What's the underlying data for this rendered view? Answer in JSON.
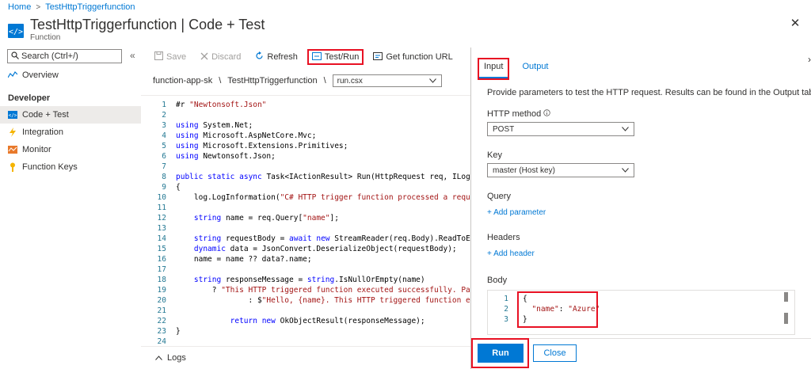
{
  "breadcrumb": {
    "home": "Home",
    "current": "TestHttpTriggerfunction"
  },
  "header": {
    "title": "TestHttpTriggerfunction | Code + Test",
    "subtitle": "Function",
    "close": "✕"
  },
  "sidebar": {
    "search_placeholder": "Search (Ctrl+/)",
    "collapse": "«",
    "overview": "Overview",
    "section_developer": "Developer",
    "items": [
      {
        "label": "Code + Test",
        "icon": "code-icon"
      },
      {
        "label": "Integration",
        "icon": "lightning-icon"
      },
      {
        "label": "Monitor",
        "icon": "monitor-icon"
      },
      {
        "label": "Function Keys",
        "icon": "key-icon"
      }
    ]
  },
  "toolbar": {
    "save": "Save",
    "discard": "Discard",
    "refresh": "Refresh",
    "test_run": "Test/Run",
    "get_url": "Get function URL"
  },
  "path": {
    "app": "function-app-sk",
    "sep1": "\\",
    "function": "TestHttpTriggerfunction",
    "sep2": "\\",
    "file": "run.csx"
  },
  "code_lines": [
    {
      "n": "1",
      "text": "#r \"Newtonsoft.Json\""
    },
    {
      "n": "2",
      "text": ""
    },
    {
      "n": "3",
      "text": "using System.Net;"
    },
    {
      "n": "4",
      "text": "using Microsoft.AspNetCore.Mvc;"
    },
    {
      "n": "5",
      "text": "using Microsoft.Extensions.Primitives;"
    },
    {
      "n": "6",
      "text": "using Newtonsoft.Json;"
    },
    {
      "n": "7",
      "text": ""
    },
    {
      "n": "8",
      "text": "public static async Task<IActionResult> Run(HttpRequest req, ILogger l"
    },
    {
      "n": "9",
      "text": "{"
    },
    {
      "n": "10",
      "text": "    log.LogInformation(\"C# HTTP trigger function processed a request.\""
    },
    {
      "n": "11",
      "text": ""
    },
    {
      "n": "12",
      "text": "    string name = req.Query[\"name\"];"
    },
    {
      "n": "13",
      "text": ""
    },
    {
      "n": "14",
      "text": "    string requestBody = await new StreamReader(req.Body).ReadToEndAsy"
    },
    {
      "n": "15",
      "text": "    dynamic data = JsonConvert.DeserializeObject(requestBody);"
    },
    {
      "n": "16",
      "text": "    name = name ?? data?.name;"
    },
    {
      "n": "17",
      "text": ""
    },
    {
      "n": "18",
      "text": "    string responseMessage = string.IsNullOrEmpty(name)"
    },
    {
      "n": "19",
      "text": "        ? \"This HTTP triggered function executed successfully. Pass a"
    },
    {
      "n": "20",
      "text": "                : $\"Hello, {name}. This HTTP triggered function execut"
    },
    {
      "n": "21",
      "text": ""
    },
    {
      "n": "22",
      "text": "            return new OkObjectResult(responseMessage);"
    },
    {
      "n": "23",
      "text": "}"
    },
    {
      "n": "24",
      "text": ""
    }
  ],
  "logs": {
    "label": "Logs"
  },
  "panel": {
    "tabs": {
      "input": "Input",
      "output": "Output"
    },
    "description": "Provide parameters to test the HTTP request. Results can be found in the Output tab.",
    "http_method_label": "HTTP method",
    "http_method_value": "POST",
    "key_label": "Key",
    "key_value": "master (Host key)",
    "query_label": "Query",
    "add_parameter": "+ Add parameter",
    "headers_label": "Headers",
    "add_header": "+ Add header",
    "body_label": "Body",
    "body_lines": [
      {
        "n": "1",
        "text": "{"
      },
      {
        "n": "2",
        "text": "  \"name\": \"Azure\""
      },
      {
        "n": "3",
        "text": "}"
      }
    ],
    "run": "Run",
    "close": "Close"
  },
  "colors": {
    "accent": "#0078d4",
    "highlight": "#e81123"
  }
}
